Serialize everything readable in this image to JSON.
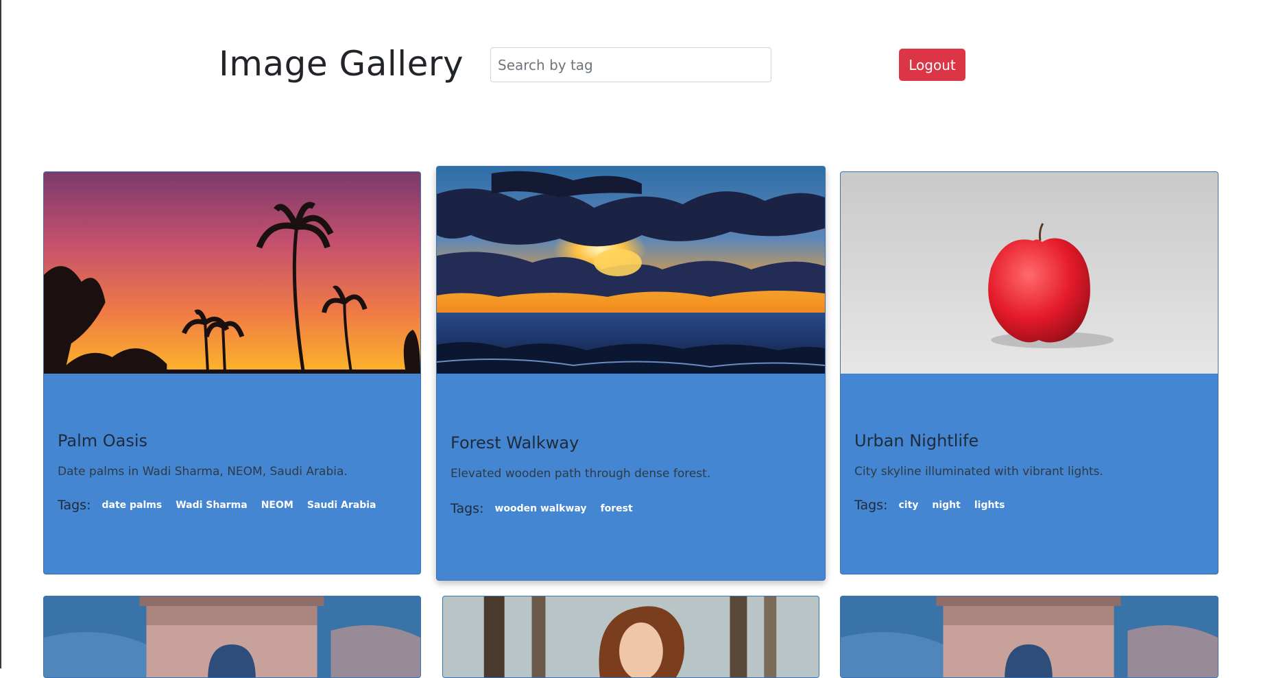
{
  "header": {
    "title": "Image Gallery",
    "search_placeholder": "Search by tag",
    "logout_label": "Logout"
  },
  "cards": [
    {
      "title": "Palm Oasis",
      "description": "Date palms in Wadi Sharma, NEOM, Saudi Arabia.",
      "tags_label": "Tags:",
      "tags": [
        "date palms",
        "Wadi Sharma",
        "NEOM",
        "Saudi Arabia"
      ]
    },
    {
      "title": "Forest Walkway",
      "description": "Elevated wooden path through dense forest.",
      "tags_label": "Tags:",
      "tags": [
        "wooden walkway",
        "forest"
      ]
    },
    {
      "title": "Urban Nightlife",
      "description": "City skyline illuminated with vibrant lights.",
      "tags_label": "Tags:",
      "tags": [
        "city",
        "night",
        "lights"
      ]
    }
  ],
  "colors": {
    "card_body": "#4486d2",
    "logout": "#dc3545",
    "tag_text": "#ffffff"
  }
}
